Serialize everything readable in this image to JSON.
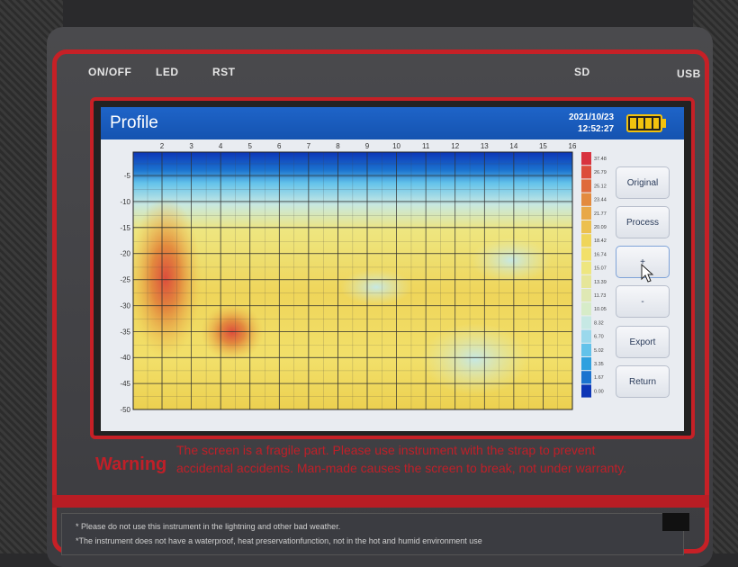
{
  "device": {
    "labels": {
      "on_off": "ON/OFF",
      "led": "LED",
      "rst": "RST",
      "sd": "SD",
      "usb": "USB"
    },
    "warning_title": "Warning",
    "warning_lines": [
      "The screen is a fragile part. Please use instrument with the strap to prevent",
      "accidental accidents. Man-made causes the screen to break, not under warranty."
    ],
    "footer_lines": [
      "* Please do not use this instrument in the lightning and other bad weather.",
      "*The instrument does not have a waterproof, heat preservationfunction, not in the hot and humid environment use"
    ]
  },
  "screen": {
    "title": "Profile",
    "date": "2021/10/23",
    "time": "12:52:27",
    "battery_icon": "battery-full-icon",
    "buttons": {
      "original": "Original",
      "process": "Process",
      "zoom_in": "+",
      "zoom_out": "-",
      "export": "Export",
      "return": "Return"
    },
    "pointer_icon": "mouse-pointer-icon"
  },
  "chart_data": {
    "type": "heatmap",
    "x_ticks": [
      "2",
      "3",
      "4",
      "5",
      "6",
      "7",
      "8",
      "9",
      "10",
      "11",
      "12",
      "13",
      "14",
      "15",
      "16"
    ],
    "y_ticks": [
      "-5",
      "-10",
      "-15",
      "-20",
      "-25",
      "-30",
      "-35",
      "-40",
      "-45",
      "-50"
    ],
    "legend_values": [
      "37.48",
      "26.79",
      "25.12",
      "23.44",
      "21.77",
      "20.09",
      "18.42",
      "16.74",
      "15.07",
      "13.39",
      "11.73",
      "10.05",
      "8.32",
      "6.70",
      "5.02",
      "3.35",
      "1.67",
      "0.00"
    ],
    "legend_colors": [
      "#d8333f",
      "#dc4d3b",
      "#df6a3b",
      "#e38a3e",
      "#e8a848",
      "#ecc04f",
      "#efd55a",
      "#f2e06a",
      "#eee680",
      "#e6e69a",
      "#dfe8b4",
      "#d7ecc8",
      "#c6e8e4",
      "#9ad8ec",
      "#63c2ea",
      "#2fa0df",
      "#1b73cf",
      "#0d35b6"
    ]
  }
}
